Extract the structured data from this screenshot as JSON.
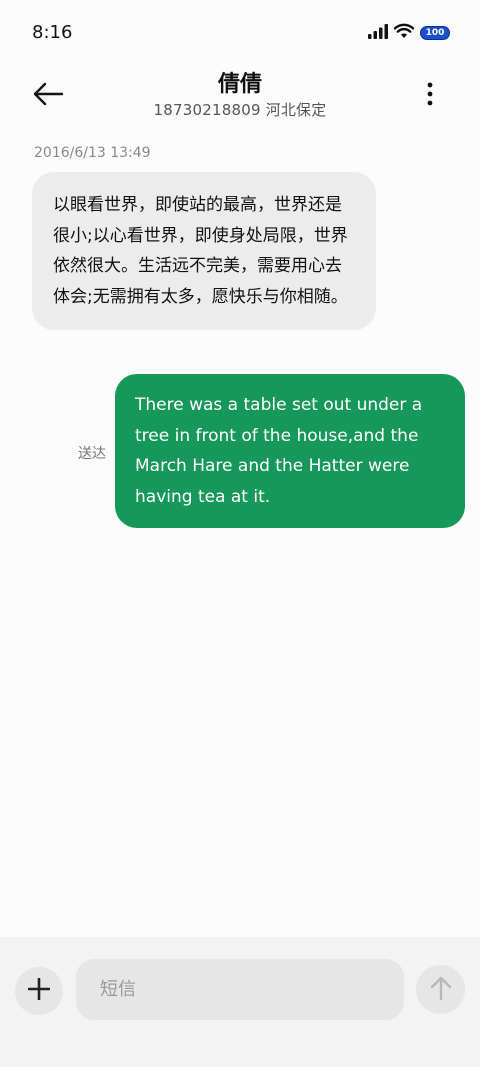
{
  "status_bar": {
    "time": "8:16",
    "battery": "100",
    "icons": [
      "signal-icon",
      "wifi-icon",
      "battery-icon"
    ]
  },
  "header": {
    "title": "倩倩",
    "subtitle": "18730218809 河北保定",
    "back_icon": "arrow-left-icon",
    "more_icon": "more-vertical-icon"
  },
  "messages": [
    {
      "direction": "incoming",
      "timestamp": "2016/6/13 13:49",
      "text": "以眼看世界，即使站的最高，世界还是很小;以心看世界，即使身处局限，世界依然很大。生活远不完美，需要用心去体会;无需拥有太多，愿快乐与你相随。"
    },
    {
      "direction": "outgoing",
      "status": "送达",
      "text": "There was a table set out under a tree in front of the house,and the March Hare and the Hatter were having tea at it."
    }
  ],
  "composer": {
    "placeholder": "短信",
    "add_icon": "plus-icon",
    "send_icon": "arrow-up-icon"
  },
  "colors": {
    "outgoing_bubble": "#16985a",
    "incoming_bubble": "#ececec",
    "background": "#fcfcfc",
    "composer_bg": "#f3f3f3",
    "battery": "#1a4fd0"
  }
}
